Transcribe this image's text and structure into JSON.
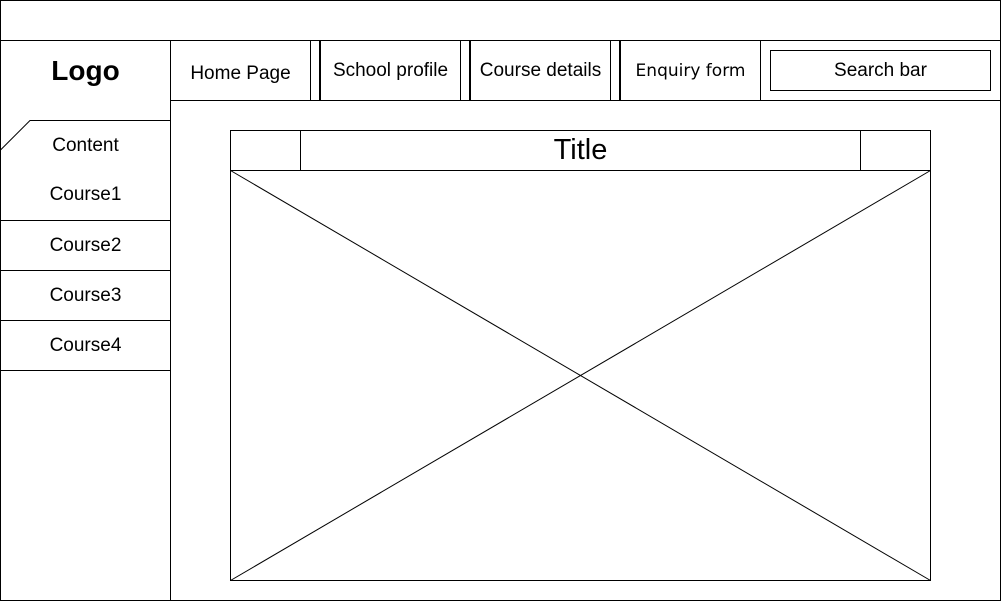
{
  "logo": "Logo",
  "nav": {
    "home": "Home Page",
    "school": "School profile",
    "course": "Course details",
    "enquiry": "Enquiry form"
  },
  "search": {
    "label": "Search bar"
  },
  "sidebar": {
    "content_tab": "Content",
    "items": [
      {
        "label": "Course1"
      },
      {
        "label": "Course2"
      },
      {
        "label": "Course3"
      },
      {
        "label": "Course4"
      }
    ]
  },
  "main": {
    "title": "Title"
  }
}
